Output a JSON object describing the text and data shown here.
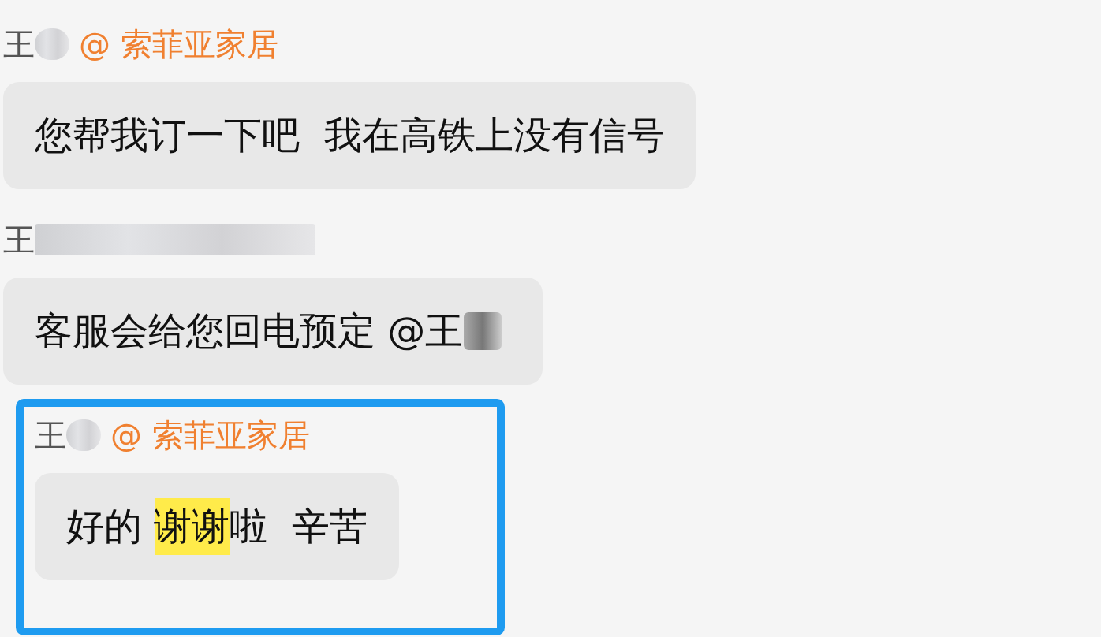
{
  "messages": [
    {
      "sender": {
        "parts": [
          {
            "kind": "text",
            "text": "王"
          },
          {
            "kind": "redaction_short"
          }
        ],
        "mention": "@ 索菲亚家居"
      },
      "outlined": false,
      "segments": [
        {
          "kind": "text",
          "text": "您帮我订一下吧  我在高铁上没有信号"
        }
      ]
    },
    {
      "sender": {
        "parts": [
          {
            "kind": "text",
            "text": "王"
          },
          {
            "kind": "redaction_long"
          }
        ]
      },
      "outlined": false,
      "segments": [
        {
          "kind": "text",
          "text": "客服会给您回电预定 @王"
        },
        {
          "kind": "redaction"
        }
      ]
    },
    {
      "sender": {
        "parts": [
          {
            "kind": "text",
            "text": "王"
          },
          {
            "kind": "redaction_short"
          }
        ],
        "mention": "@ 索菲亚家居"
      },
      "outlined": true,
      "segments": [
        {
          "kind": "text",
          "text": "好的 "
        },
        {
          "kind": "highlight",
          "text": "谢谢"
        },
        {
          "kind": "text",
          "text": "啦  辛苦"
        }
      ]
    }
  ]
}
